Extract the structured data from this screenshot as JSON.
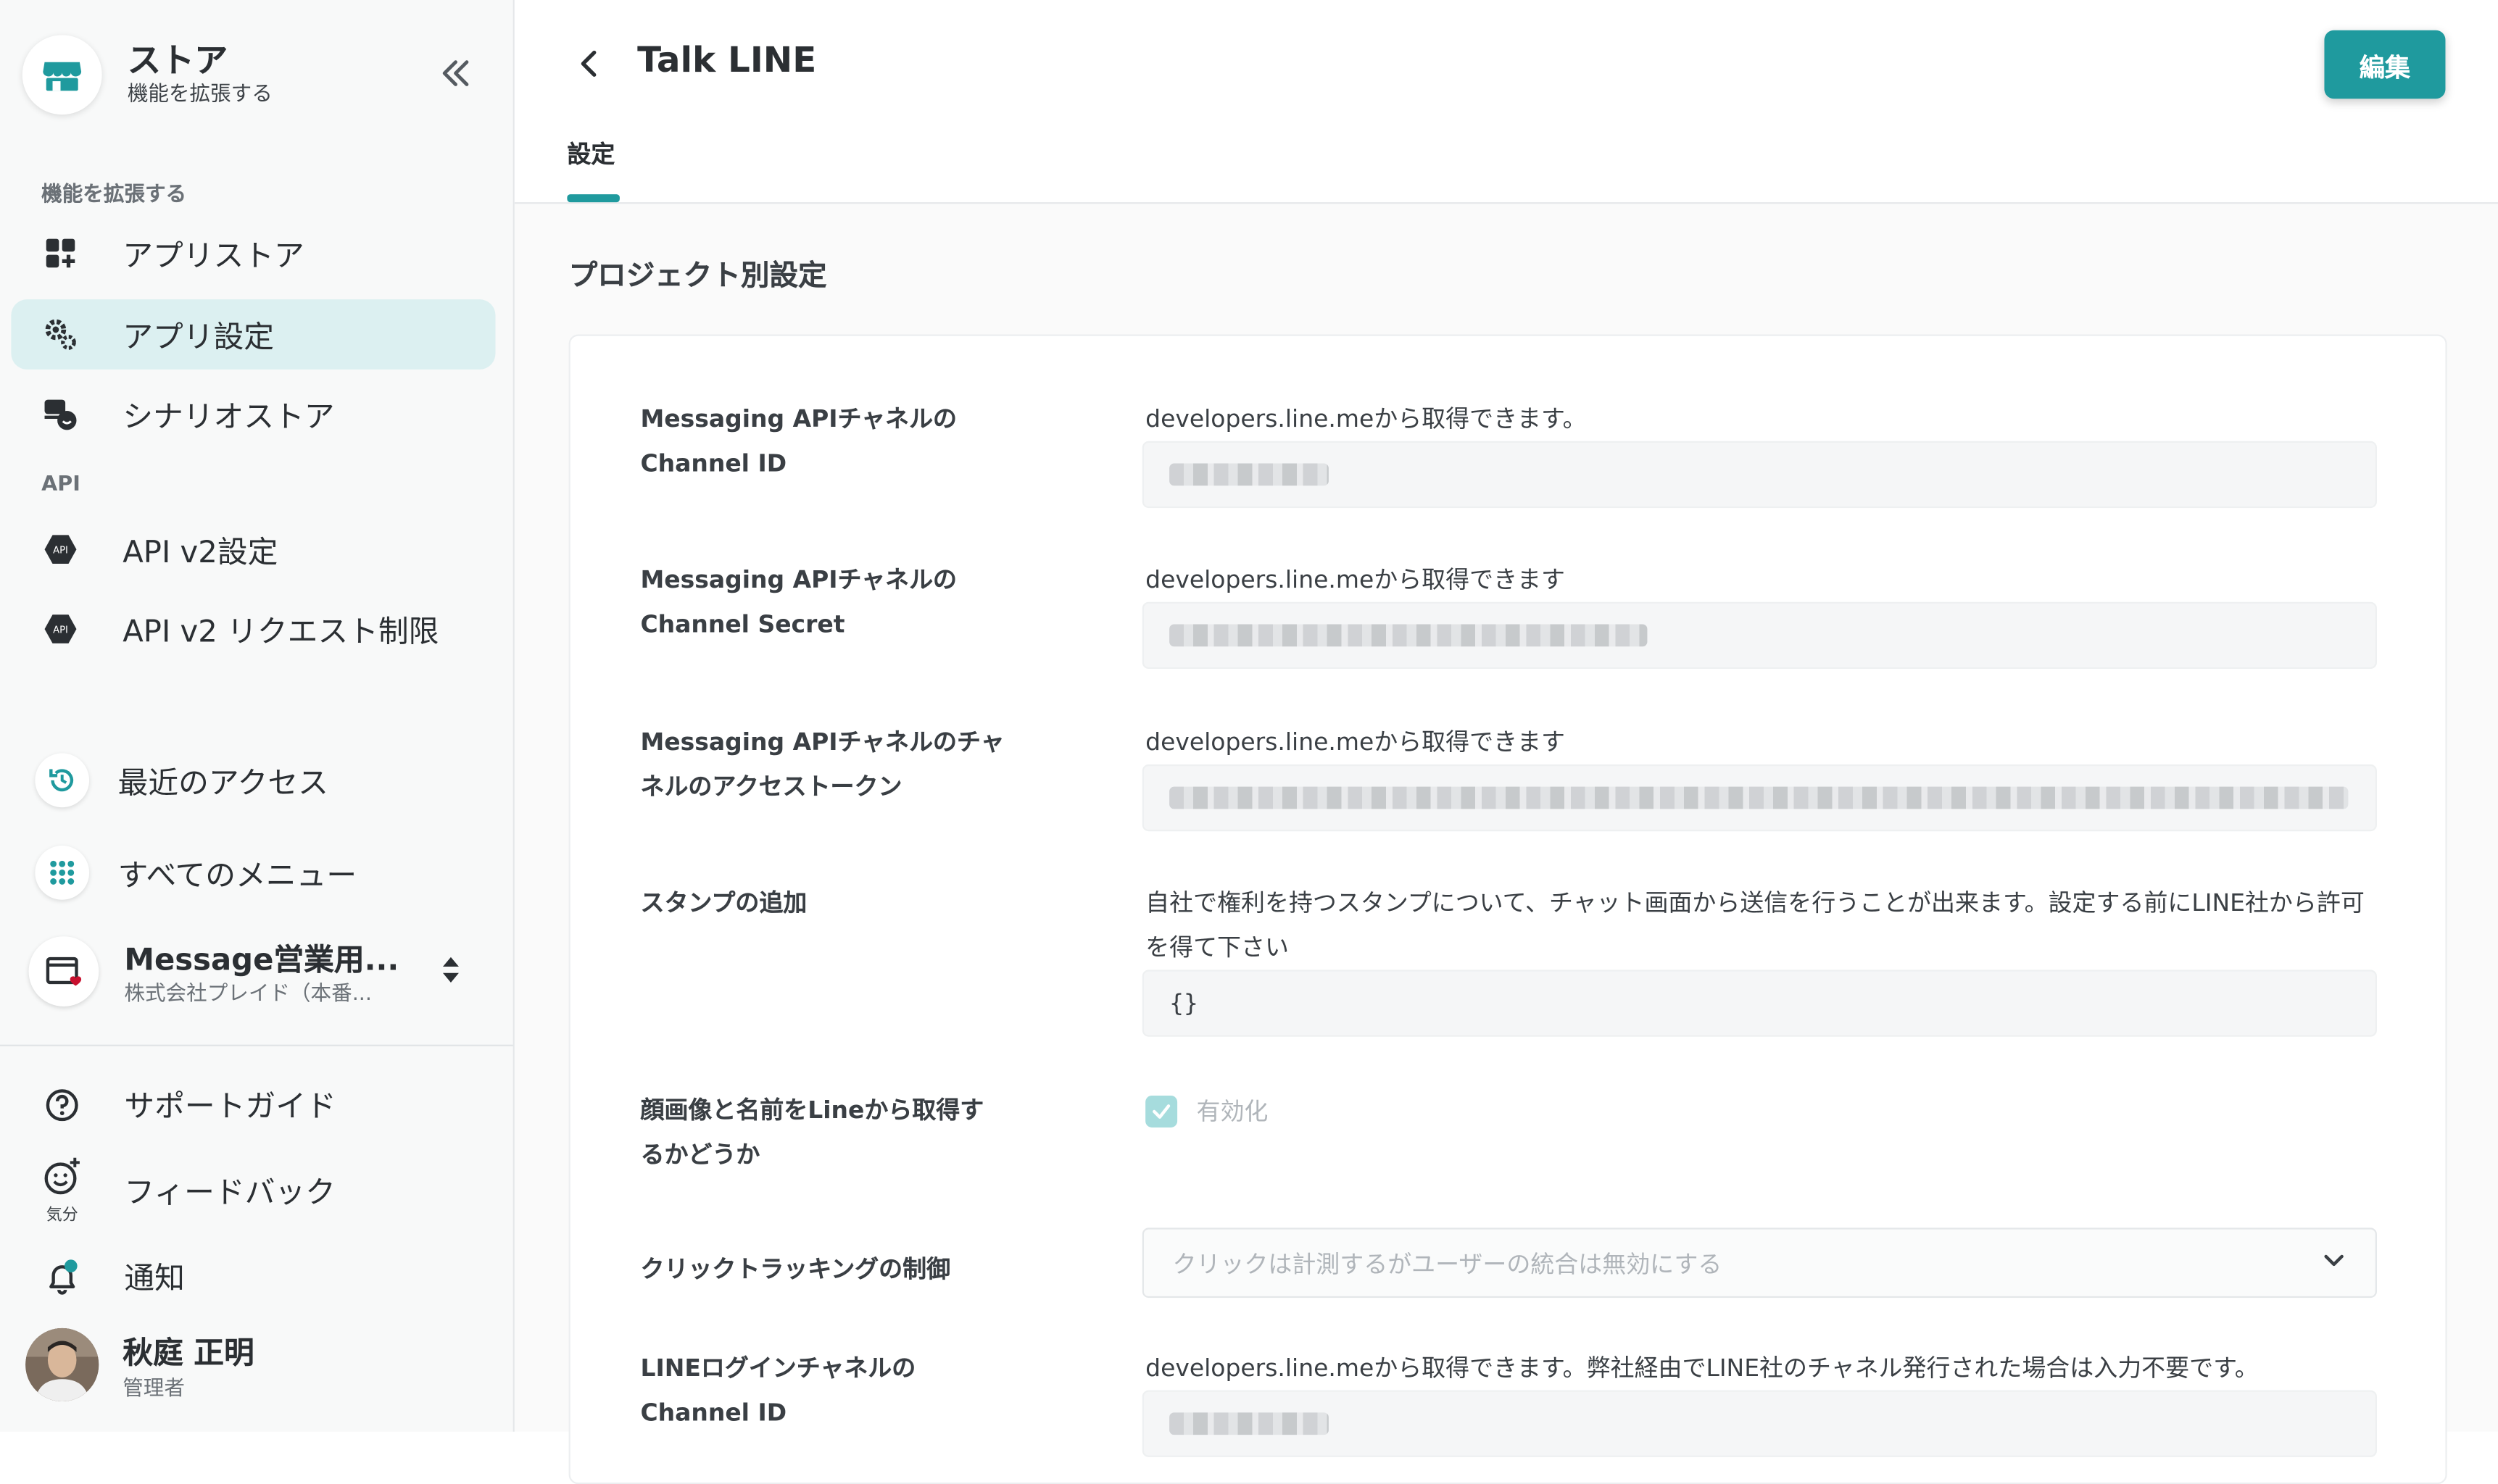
{
  "brand": {
    "title": "ストア",
    "subtitle": "機能を拡張する"
  },
  "sidebar": {
    "section_extend": "機能を拡張する",
    "items_extend": [
      {
        "label": "アプリストア",
        "icon": "app-store-icon"
      },
      {
        "label": "アプリ設定",
        "icon": "gears-icon",
        "active": true
      },
      {
        "label": "シナリオストア",
        "icon": "scenario-store-icon"
      }
    ],
    "section_api": "API",
    "items_api": [
      {
        "label": "API v2設定",
        "icon": "api-icon"
      },
      {
        "label": "API v2 リクエスト制限",
        "icon": "api-icon"
      }
    ],
    "recent": "最近のアクセス",
    "all_menu": "すべてのメニュー",
    "project": {
      "name": "Message営業用...",
      "org": "株式会社プレイド（本番..."
    },
    "support": "サポートガイド",
    "feedback": "フィードバック",
    "feedback_mood": "気分",
    "notifications": "通知",
    "user": {
      "name": "秋庭 正明",
      "role": "管理者"
    }
  },
  "header": {
    "title": "Talk LINE",
    "edit_label": "編集",
    "tab": "設定"
  },
  "main": {
    "section_title": "プロジェクト別設定",
    "rows": {
      "channel_id": {
        "label": "Messaging APIチャネルの Channel ID",
        "help": "developers.line.meから取得できます。"
      },
      "channel_secret": {
        "label": "Messaging APIチャネルの Channel Secret",
        "help": "developers.line.meから取得できます"
      },
      "access_token": {
        "label": "Messaging APIチャネルのチャネルのアクセストークン",
        "help": "developers.line.meから取得できます"
      },
      "stamp": {
        "label": "スタンプの追加",
        "help": "自社で権利を持つスタンプについて、チャット画面から送信を行うことが出来ます。設定する前にLINE社から許可を得て下さい",
        "value": "{}"
      },
      "profile": {
        "label": "顔画像と名前をLineから取得するかどうか",
        "checkbox_label": "有効化",
        "checked": true
      },
      "click_tracking": {
        "label": "クリックトラッキングの制御",
        "selected": "クリックは計測するがユーザーの統合は無効にする"
      },
      "login_channel": {
        "label": "LINEログインチャネルの Channel ID",
        "help": "developers.line.meから取得できます。弊社経由でLINE社のチャネル発行された場合は入力不要です。"
      }
    }
  },
  "colors": {
    "accent": "#1f9a9e",
    "active_bg": "#dcf0f1",
    "danger": "#c8102e"
  }
}
